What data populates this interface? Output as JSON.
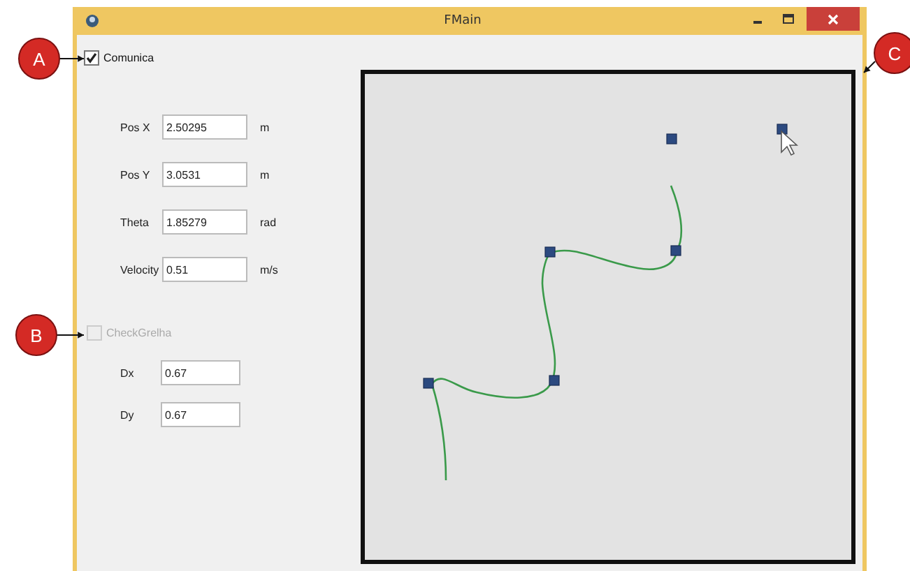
{
  "window": {
    "title": "FMain"
  },
  "comunica": {
    "label": "Comunica",
    "checked": true,
    "disabled": false
  },
  "fields": [
    {
      "label": "Pos X",
      "value": "2.50295",
      "unit": "m"
    },
    {
      "label": "Pos Y",
      "value": "3.0531",
      "unit": "m"
    },
    {
      "label": "Theta",
      "value": "1.85279",
      "unit": "rad"
    },
    {
      "label": "Velocity",
      "value": "0.51",
      "unit": "m/s"
    }
  ],
  "check_grelha": {
    "label": "CheckGrelha",
    "checked": false,
    "disabled": true
  },
  "grid_fields": [
    {
      "label": "Dx",
      "value": "0.67"
    },
    {
      "label": "Dy",
      "value": "0.67"
    }
  ],
  "callouts": [
    {
      "label": "A"
    },
    {
      "label": "B"
    },
    {
      "label": "C"
    }
  ]
}
